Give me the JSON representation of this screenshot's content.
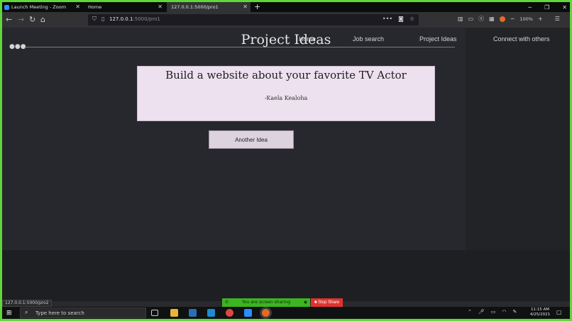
{
  "browser": {
    "tabs": [
      {
        "label": "Launch Meeting - Zoom"
      },
      {
        "label": "Home"
      },
      {
        "label": "127.0.0.1:5000/pro1"
      }
    ],
    "url_host": "127.0.0.1",
    "url_path": ":5000/pro1",
    "zoom_level": "100%",
    "status_url": "127.0.0.1:5000/pro2"
  },
  "site": {
    "nav": {
      "home": "Home",
      "job_search": "Job search",
      "project_ideas": "Project Ideas",
      "connect": "Connect with others"
    },
    "page_title": "Project Ideas",
    "idea": {
      "text": "Build a website about your favorite TV Actor",
      "author": "-Kaela Kealoha"
    },
    "another_idea_button": "Another Idea"
  },
  "zoom": {
    "sharing_text": "You are screen sharing",
    "stop_share_label": "Stop Share"
  },
  "taskbar": {
    "search_placeholder": "Type here to search",
    "time": "11:15 AM",
    "date": "4/25/2021"
  },
  "colors": {
    "screen_share_border": "#5fd63a",
    "idea_card_bg": "#ede0ef",
    "stop_share": "#e0322f"
  }
}
